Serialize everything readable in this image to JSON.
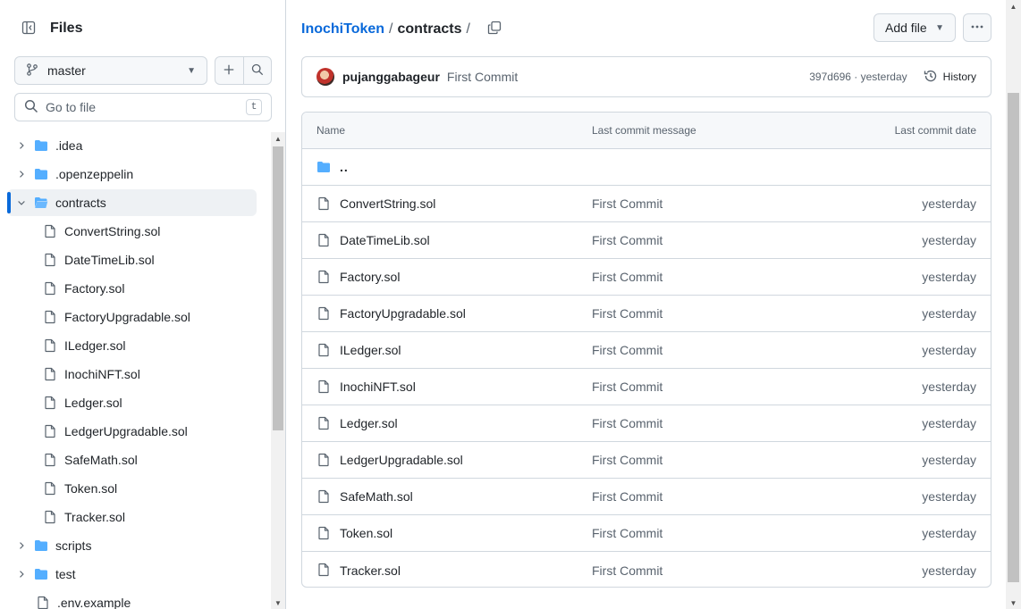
{
  "sidebar": {
    "title": "Files",
    "branch": "master",
    "goto_placeholder": "Go to file",
    "goto_shortcut": "t",
    "tree": [
      {
        "name": ".idea",
        "type": "folder",
        "expanded": false,
        "depth": 0
      },
      {
        "name": ".openzeppelin",
        "type": "folder",
        "expanded": false,
        "depth": 0
      },
      {
        "name": "contracts",
        "type": "folder",
        "expanded": true,
        "depth": 0,
        "active": true
      },
      {
        "name": "ConvertString.sol",
        "type": "file",
        "depth": 1
      },
      {
        "name": "DateTimeLib.sol",
        "type": "file",
        "depth": 1
      },
      {
        "name": "Factory.sol",
        "type": "file",
        "depth": 1
      },
      {
        "name": "FactoryUpgradable.sol",
        "type": "file",
        "depth": 1
      },
      {
        "name": "ILedger.sol",
        "type": "file",
        "depth": 1
      },
      {
        "name": "InochiNFT.sol",
        "type": "file",
        "depth": 1
      },
      {
        "name": "Ledger.sol",
        "type": "file",
        "depth": 1
      },
      {
        "name": "LedgerUpgradable.sol",
        "type": "file",
        "depth": 1
      },
      {
        "name": "SafeMath.sol",
        "type": "file",
        "depth": 1
      },
      {
        "name": "Token.sol",
        "type": "file",
        "depth": 1
      },
      {
        "name": "Tracker.sol",
        "type": "file",
        "depth": 1
      },
      {
        "name": "scripts",
        "type": "folder",
        "expanded": false,
        "depth": 0
      },
      {
        "name": "test",
        "type": "folder",
        "expanded": false,
        "depth": 0
      },
      {
        "name": ".env.example",
        "type": "file",
        "depth": 0
      }
    ]
  },
  "breadcrumb": {
    "repo": "InochiToken",
    "sep1": "/",
    "current": "contracts",
    "sep2": "/"
  },
  "toolbar": {
    "add_file_label": "Add file"
  },
  "commit": {
    "author": "pujanggabageur",
    "message": "First Commit",
    "sha_time": "397d696 · yesterday",
    "history_label": "History"
  },
  "table": {
    "headers": {
      "name": "Name",
      "message": "Last commit message",
      "date": "Last commit date"
    },
    "parent_label": "..",
    "rows": [
      {
        "name": "ConvertString.sol",
        "message": "First Commit",
        "date": "yesterday"
      },
      {
        "name": "DateTimeLib.sol",
        "message": "First Commit",
        "date": "yesterday"
      },
      {
        "name": "Factory.sol",
        "message": "First Commit",
        "date": "yesterday"
      },
      {
        "name": "FactoryUpgradable.sol",
        "message": "First Commit",
        "date": "yesterday"
      },
      {
        "name": "ILedger.sol",
        "message": "First Commit",
        "date": "yesterday"
      },
      {
        "name": "InochiNFT.sol",
        "message": "First Commit",
        "date": "yesterday"
      },
      {
        "name": "Ledger.sol",
        "message": "First Commit",
        "date": "yesterday"
      },
      {
        "name": "LedgerUpgradable.sol",
        "message": "First Commit",
        "date": "yesterday"
      },
      {
        "name": "SafeMath.sol",
        "message": "First Commit",
        "date": "yesterday"
      },
      {
        "name": "Token.sol",
        "message": "First Commit",
        "date": "yesterday"
      },
      {
        "name": "Tracker.sol",
        "message": "First Commit",
        "date": "yesterday"
      }
    ]
  },
  "colors": {
    "accent": "#0969da",
    "folder": "#54aeff",
    "muted": "#59636e",
    "border": "#d0d7de"
  }
}
